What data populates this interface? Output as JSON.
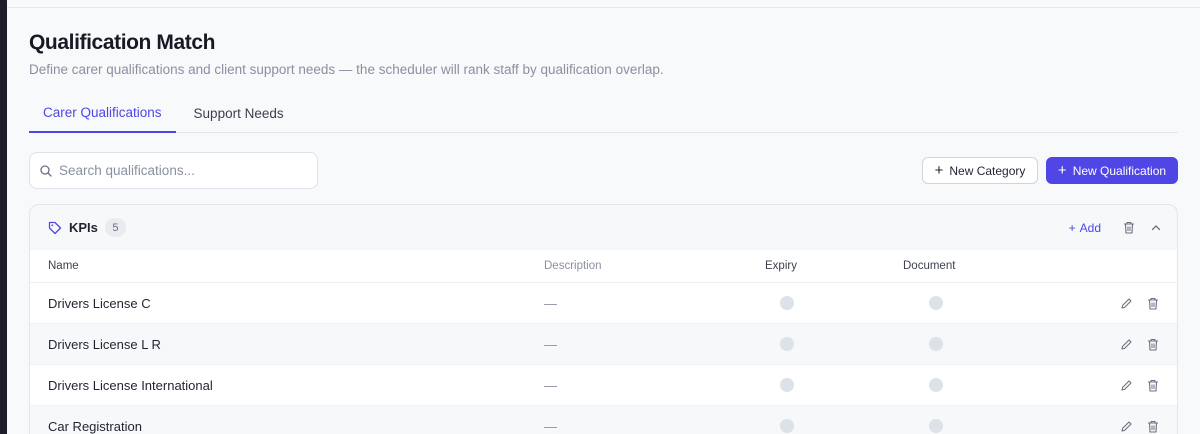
{
  "page": {
    "title": "Qualification Match",
    "subtitle": "Define carer qualifications and client support needs — the scheduler will rank staff by qualification overlap."
  },
  "tabs": [
    {
      "label": "Carer Qualifications",
      "active": true
    },
    {
      "label": "Support Needs",
      "active": false
    }
  ],
  "search": {
    "placeholder": "Search qualifications..."
  },
  "toolbar": {
    "new_category_label": "New Category",
    "new_qualification_label": "New Qualification"
  },
  "category": {
    "name": "KPIs",
    "count": "5",
    "add_label": "Add"
  },
  "table": {
    "columns": [
      "Name",
      "Description",
      "Expiry",
      "Document"
    ],
    "rows": [
      {
        "name": "Drivers License C",
        "description": "—"
      },
      {
        "name": "Drivers License L R",
        "description": "—"
      },
      {
        "name": "Drivers License International",
        "description": "—"
      },
      {
        "name": "Car Registration",
        "description": "—"
      }
    ]
  },
  "colors": {
    "accent": "#4f46e5",
    "dot": "#dde1e8"
  }
}
